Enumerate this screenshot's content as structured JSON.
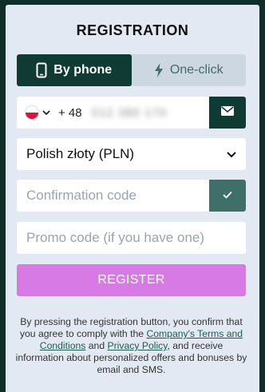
{
  "header": {
    "title": "REGISTRATION"
  },
  "tabs": [
    {
      "label": "By phone",
      "icon": "smartphone-icon",
      "active": true
    },
    {
      "label": "One-click",
      "icon": "lightning-icon",
      "active": false
    }
  ],
  "phone": {
    "country_flag": "poland-flag-icon",
    "prefix": "+ 48",
    "value": "512 380 170"
  },
  "currency": {
    "selected": "Polish złoty (PLN)"
  },
  "confirmation": {
    "placeholder": "Confirmation code"
  },
  "promo": {
    "placeholder": "Promo code (if you have one)"
  },
  "register_button": {
    "label": "REGISTER"
  },
  "terms": {
    "part1": "By pressing the registration button, you confirm that you agree to comply with the ",
    "link1": "Company's Terms and Conditions",
    "part2": " and ",
    "link2": "Privacy Policy",
    "part3": ", and receive information about personalized offers and bonuses by email and SMS."
  },
  "colors": {
    "background": "#0f2e2a",
    "panel": "#e3e9f2",
    "primary": "#0f3b34",
    "confirm_button": "#3f6f66",
    "register": "#d77ae6"
  }
}
